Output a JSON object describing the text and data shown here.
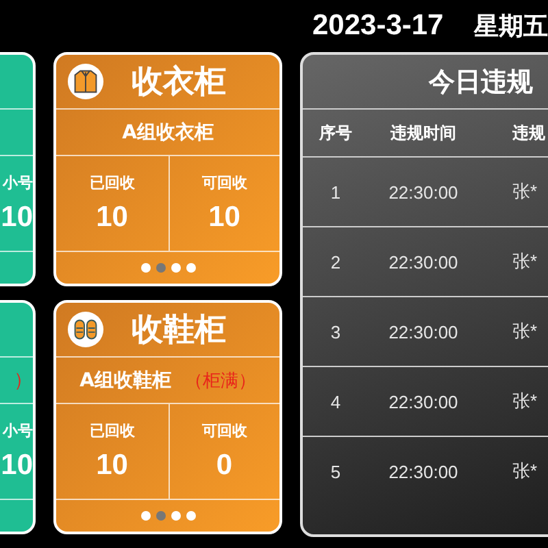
{
  "date": "2023-3-17",
  "weekday": "星期五",
  "side_cards": [
    {
      "stat_label": "小号",
      "stat_value": "10"
    },
    {
      "note": "）",
      "stat_label": "小号",
      "stat_value": "10"
    }
  ],
  "lockers": [
    {
      "kind": "jacket",
      "title": "收衣柜",
      "group": "A组收衣柜",
      "stats": [
        {
          "label": "已回收",
          "value": "10"
        },
        {
          "label": "可回收",
          "value": "10"
        }
      ],
      "pages": [
        {
          "selected": false
        },
        {
          "selected": true
        },
        {
          "selected": false
        },
        {
          "selected": false
        }
      ]
    },
    {
      "kind": "shoes",
      "title": "收鞋柜",
      "group": "A组收鞋柜",
      "status": "（柜满）",
      "stats": [
        {
          "label": "已回收",
          "value": "10"
        },
        {
          "label": "可回收",
          "value": "0"
        }
      ],
      "pages": [
        {
          "selected": false
        },
        {
          "selected": true
        },
        {
          "selected": false
        },
        {
          "selected": false
        }
      ]
    }
  ],
  "violations": {
    "title": "今日违规",
    "columns": [
      "序号",
      "违规时间",
      "违规"
    ],
    "rows": [
      [
        "1",
        "22:30:00",
        "张*"
      ],
      [
        "2",
        "22:30:00",
        "张*"
      ],
      [
        "3",
        "22:30:00",
        "张*"
      ],
      [
        "4",
        "22:30:00",
        "张*"
      ],
      [
        "5",
        "22:30:00",
        "张*"
      ]
    ]
  }
}
